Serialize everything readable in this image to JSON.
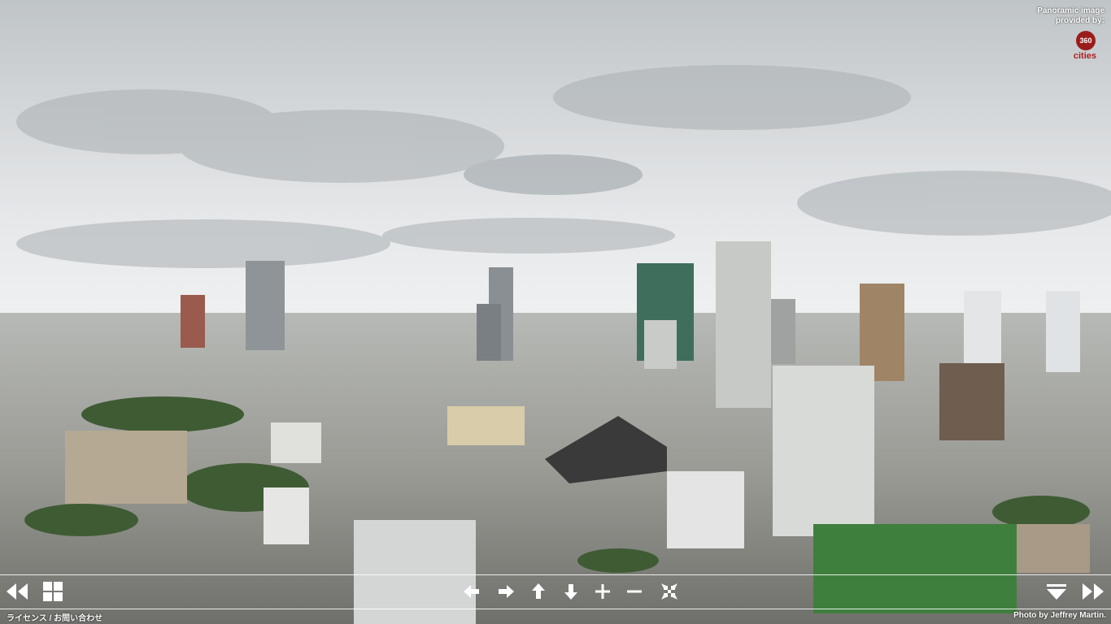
{
  "credit": {
    "provided_by_line1": "Panoramic image",
    "provided_by_line2": "provided by:",
    "logo_number": "360",
    "logo_word": "cities"
  },
  "controls": {
    "prev": "rewind-icon",
    "grid": "grid-icon",
    "left": "arrow-left-icon",
    "right": "arrow-right-icon",
    "up": "arrow-up-icon",
    "down": "arrow-down-icon",
    "zoom_in": "plus-icon",
    "zoom_out": "minus-icon",
    "fullscreen": "shrink-icon",
    "menu": "triangle-down-icon",
    "next": "fast-forward-icon"
  },
  "footer": {
    "license_link": "ライセンス / お問い合わせ",
    "photo_credit": "Photo by Jeffrey Martin."
  }
}
